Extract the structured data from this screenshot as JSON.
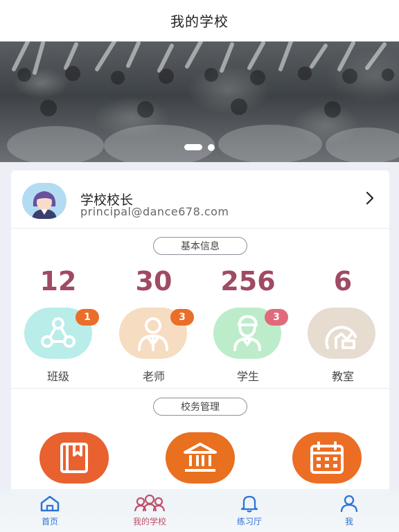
{
  "header": {
    "title": "我的学校"
  },
  "banner": {
    "image_icon": "dance-performance-photo",
    "slide_count": 2,
    "active_slide": 1
  },
  "profile": {
    "name": "学校校长",
    "email": "principal@dance678.com",
    "avatar_icon": "female-avatar",
    "chevron_icon": "chevron-right-icon"
  },
  "basic_info": {
    "title": "基本信息",
    "stats": [
      {
        "value": "12",
        "label": "班级",
        "badge": "1",
        "icon": "class-network-icon",
        "color": "#b8ede9",
        "badge_color": "#ea6d2a"
      },
      {
        "value": "30",
        "label": "老师",
        "badge": "3",
        "icon": "teacher-icon",
        "color": "#f6dcc0",
        "badge_color": "#ea6d2a"
      },
      {
        "value": "256",
        "label": "学生",
        "badge": "3",
        "icon": "student-icon",
        "color": "#bdeccb",
        "badge_color": "#e06a7c"
      },
      {
        "value": "6",
        "label": "教室",
        "badge": "",
        "icon": "classroom-chart-icon",
        "color": "#e7dcd0",
        "badge_color": ""
      }
    ]
  },
  "management": {
    "title": "校务管理",
    "items": [
      {
        "icon": "book-icon",
        "color": "#e8612f"
      },
      {
        "icon": "institution-icon",
        "color": "#e8701e"
      },
      {
        "icon": "calendar-icon",
        "color": "#ec6e24"
      }
    ]
  },
  "tabbar": {
    "items": [
      {
        "label": "首页",
        "icon": "home-icon",
        "color": "#2e73d6"
      },
      {
        "label": "我的学校",
        "icon": "people-icon",
        "color": "#c04f68"
      },
      {
        "label": "练习厅",
        "icon": "bell-icon",
        "color": "#2e73d6"
      },
      {
        "label": "我",
        "icon": "user-icon",
        "color": "#2e73d6"
      }
    ]
  }
}
